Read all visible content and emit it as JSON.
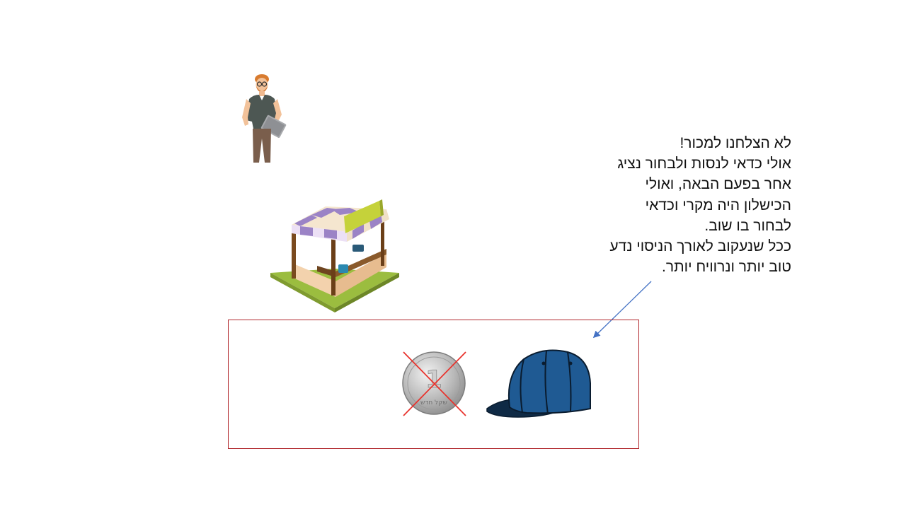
{
  "message": {
    "lines": [
      "לא הצלחנו למכור!",
      "אולי כדאי לנסות ולבחור נציג",
      "אחר בפעם הבאה, ואולי",
      "הכישלון היה מקרי וכדאי",
      "לבחור בו שוב.",
      "ככל שנעקוב לאורך הניסוי נדע",
      "טוב יותר ונרוויח יותר."
    ]
  },
  "coin": {
    "numeral": "1",
    "denomination_text": "שקל חדש",
    "crossed_out": true
  },
  "colors": {
    "frame_border": "#b0262b",
    "cross": "#e8332d",
    "arrow": "#4472c4",
    "cap_body": "#1f5a93",
    "cap_visor": "#0f2a45",
    "stall_awning_purple": "#9b83c6",
    "stall_ground": "#9bbd3f"
  },
  "icons": {
    "person": "man-with-laptop-figure",
    "stall": "market-stall-illustration",
    "coin": "one-shekel-coin",
    "cross": "cross-out-mark",
    "cap": "baseball-cap"
  }
}
